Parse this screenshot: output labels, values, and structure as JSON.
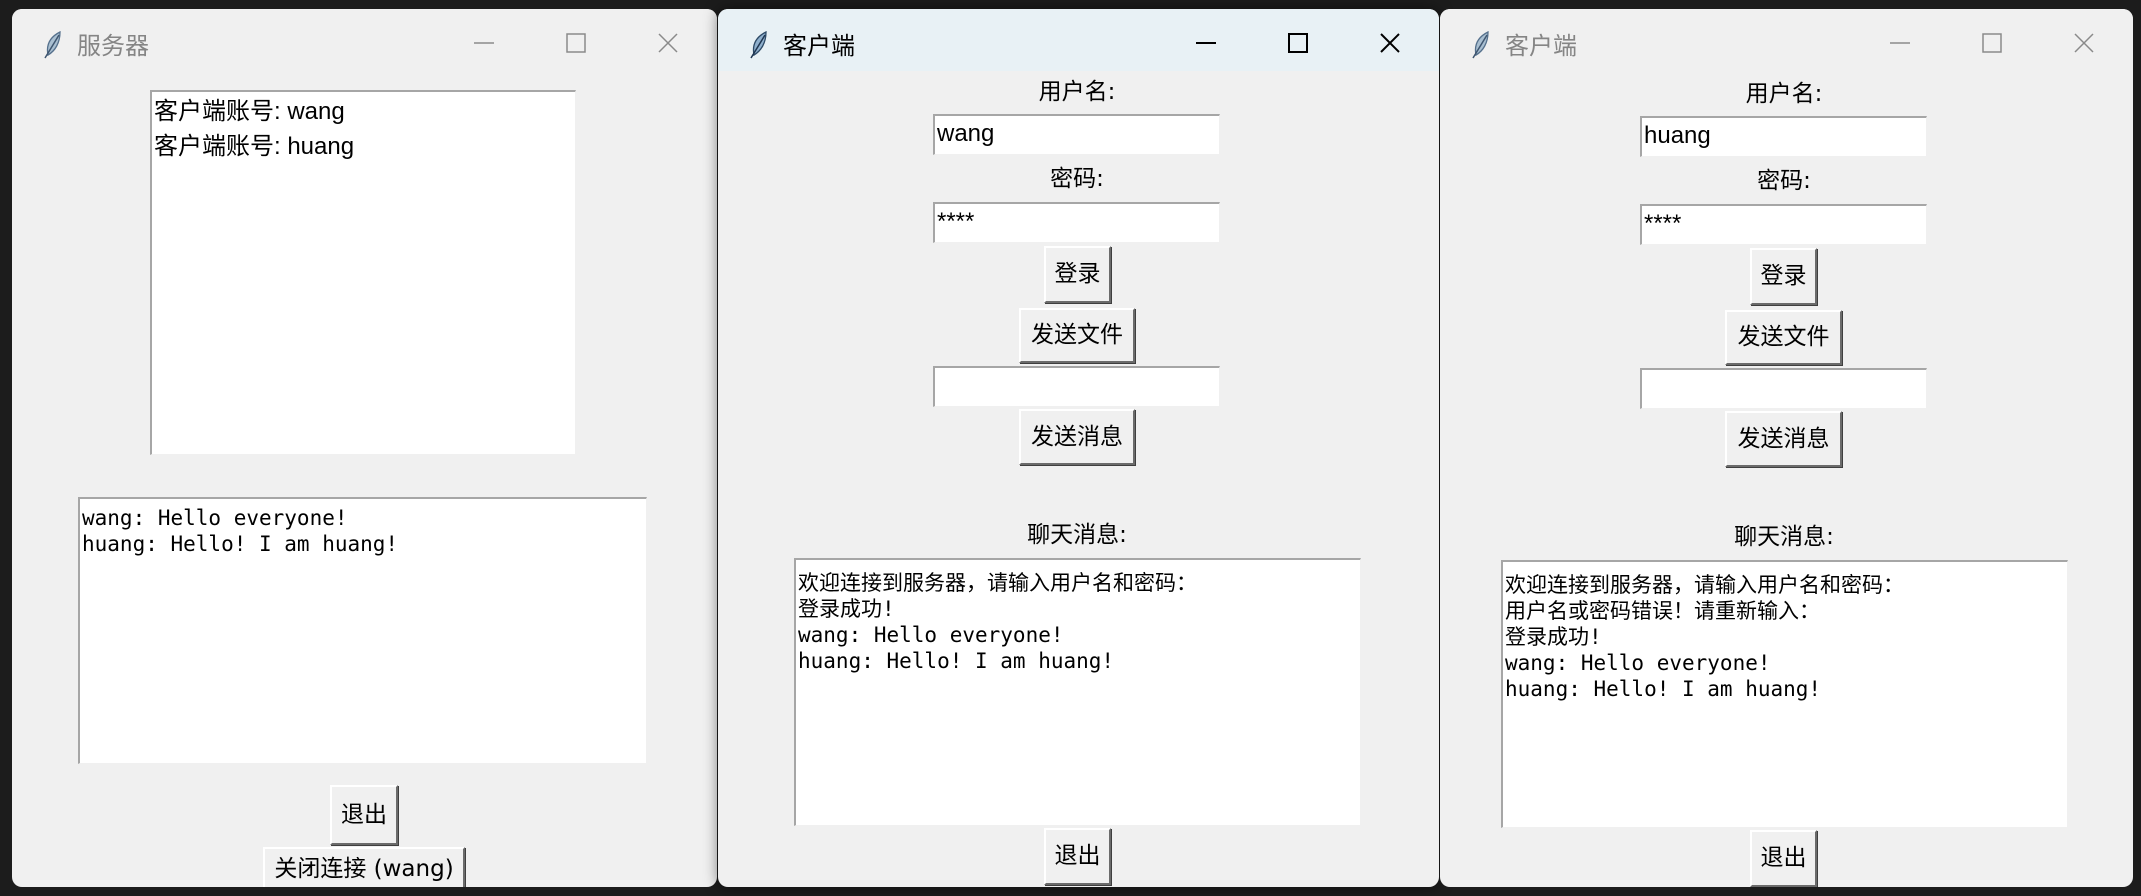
{
  "server_window": {
    "title": "服务器",
    "clients_list": [
      "客户端账号: wang",
      "客户端账号: huang"
    ],
    "messages": [
      "wang: Hello everyone!",
      "huang: Hello! I am huang!"
    ],
    "exit_label": "退出",
    "close_connection_label": "关闭连接 (wang)"
  },
  "client_wang": {
    "title": "客户端",
    "username_label": "用户名:",
    "username_value": "wang",
    "password_label": "密码:",
    "password_value": "****",
    "login_label": "登录",
    "send_file_label": "发送文件",
    "message_input_value": "",
    "send_message_label": "发送消息",
    "chat_label": "聊天消息:",
    "chat_lines": [
      "欢迎连接到服务器，请输入用户名和密码：",
      "登录成功!",
      "wang: Hello everyone!",
      "huang: Hello! I am huang!"
    ],
    "exit_label": "退出"
  },
  "client_huang": {
    "title": "客户端",
    "username_label": "用户名:",
    "username_value": "huang",
    "password_label": "密码:",
    "password_value": "****",
    "login_label": "登录",
    "send_file_label": "发送文件",
    "message_input_value": "",
    "send_message_label": "发送消息",
    "chat_label": "聊天消息:",
    "chat_lines": [
      "欢迎连接到服务器，请输入用户名和密码：",
      "用户名或密码错误！请重新输入：",
      "登录成功!",
      "wang: Hello everyone!",
      "huang: Hello! I am huang!"
    ],
    "exit_label": "退出"
  },
  "icons": [
    "feather-icon",
    "minimize-icon",
    "maximize-icon",
    "close-icon"
  ],
  "colors": {
    "window_bg": "#f0f0f0",
    "active_titlebar": "#e8f1f5",
    "inactive_title_text": "#858585",
    "active_title_text": "#000000"
  }
}
